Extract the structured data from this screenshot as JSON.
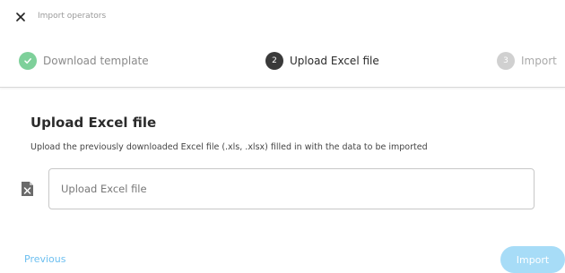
{
  "dialog": {
    "title": "Import operators",
    "close_icon": "close-icon"
  },
  "stepper": {
    "steps": [
      {
        "number": "1",
        "label": "Download template",
        "status": "completed",
        "icon": "check-icon"
      },
      {
        "number": "2",
        "label": "Upload Excel file",
        "status": "active"
      },
      {
        "number": "3",
        "label": "Import",
        "status": "pending"
      }
    ]
  },
  "content": {
    "title": "Upload Excel file",
    "description": "Upload the previously downloaded Excel file (.xls, .xlsx) filled in with the data to be imported",
    "file_icon": "excel-file-icon",
    "upload_placeholder": "Upload Excel file"
  },
  "footer": {
    "previous_label": "Previous",
    "import_label": "Import"
  },
  "colors": {
    "accent": "#6cbff0",
    "completed": "#7ed09a",
    "active": "#3a3a3a",
    "pending": "#d0d0d0",
    "import_button_disabled": "#a7dcf7"
  }
}
